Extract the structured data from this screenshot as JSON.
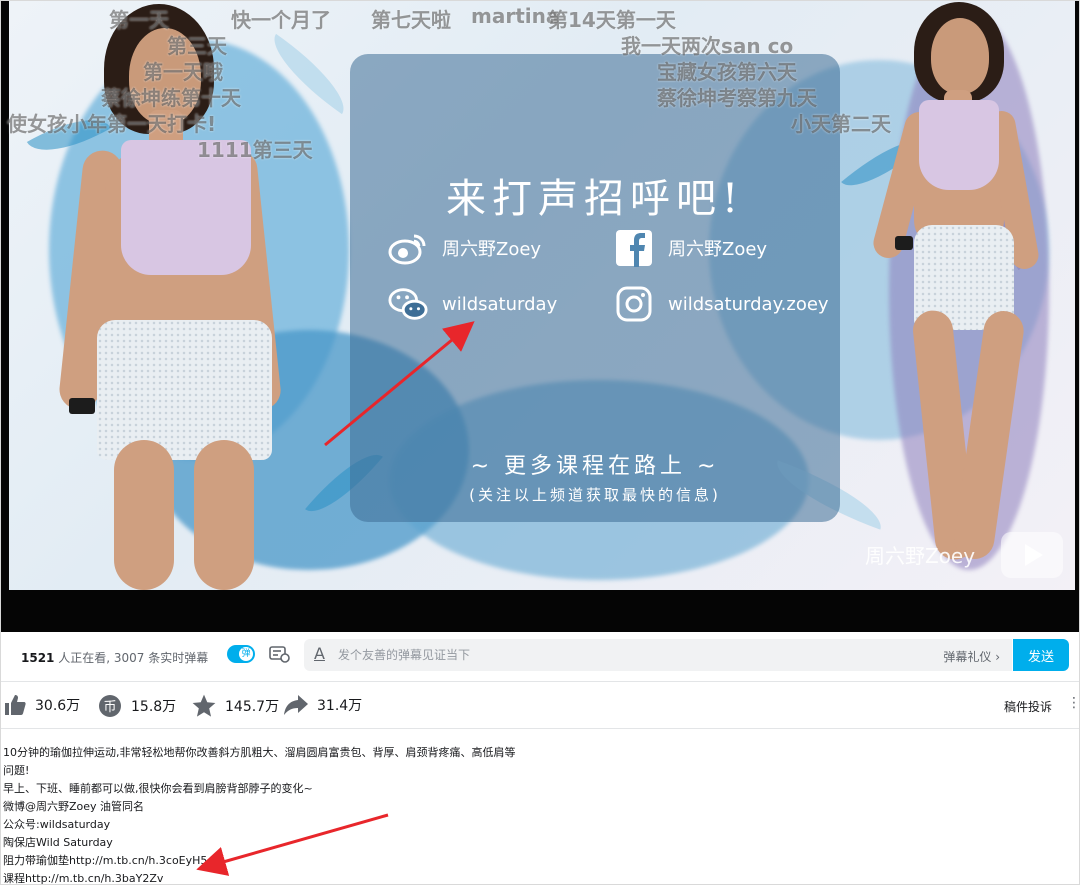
{
  "video": {
    "card_title": "来打声招呼吧!",
    "weibo": "周六野Zoey",
    "facebook": "周六野Zoey",
    "wechat": "wildsaturday",
    "instagram": "wildsaturday.zoey",
    "sub_line1": "~ 更多课程在路上 ~",
    "sub_line2": "(关注以上频道获取最快的信息)",
    "watermark": "周六野Zoey"
  },
  "danmaku": [
    "第一天",
    "快一个月了",
    "第七天啦",
    "martina",
    "第14天第一天",
    "第三天",
    "我一天两次san co",
    "第一天哦",
    "宝藏女孩第六天",
    "蔡徐坤练第十天",
    "蔡徐坤考察第九天",
    "使女孩小年第一天打卡!",
    "小天第二天",
    "1111第三天"
  ],
  "danmaku_bar": {
    "viewers_count": "1521",
    "viewers_text": " 人正在看,  3007 条实时弹幕",
    "toggle_label": "弹",
    "input_placeholder": "发个友善的弹幕见证当下",
    "etiquette": "弹幕礼仪 ›",
    "send": "发送"
  },
  "actions": {
    "like": "30.6万",
    "coin": "15.8万",
    "favorite": "145.7万",
    "share": "31.4万",
    "report": "稿件投诉"
  },
  "description": [
    "10分钟的瑜伽拉伸运动,非常轻松地帮你改善斜方肌粗大、溜肩圆肩富贵包、背厚、肩颈背疼痛、高低肩等",
    "问题!",
    "早上、下班、睡前都可以做,很快你会看到肩膀背部脖子的变化~",
    "微博@周六野Zoey 油管同名",
    "公众号:wildsaturday",
    "陶保店Wild Saturday",
    "阻力带瑜伽垫http://m.tb.cn/h.3coEyH5",
    "课程http://m.tb.cn/h.3baY2Zv"
  ],
  "colors": {
    "accent": "#00aeec",
    "annotation_arrow": "#e8262b"
  }
}
